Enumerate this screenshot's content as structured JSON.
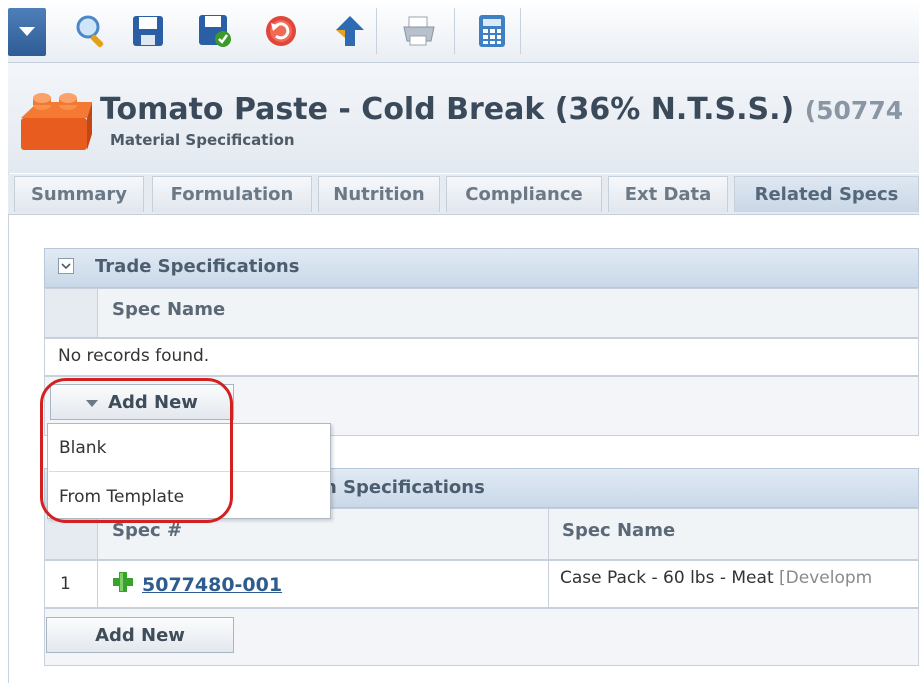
{
  "toolbar": {
    "icons": [
      "dropdown-arrow-icon",
      "search-icon",
      "save-icon",
      "save-check-icon",
      "undo-icon",
      "arrow-up-icon",
      "print-icon",
      "calculator-icon"
    ]
  },
  "header": {
    "title": "Tomato Paste - Cold Break (36% N.T.S.S.)",
    "code": "(50774",
    "subtitle": "Material Specification"
  },
  "tabs": [
    {
      "label": "Summary"
    },
    {
      "label": "Formulation"
    },
    {
      "label": "Nutrition"
    },
    {
      "label": "Compliance"
    },
    {
      "label": "Ext Data"
    },
    {
      "label": "Related Specs",
      "active": true
    }
  ],
  "trade_specs": {
    "title": "Trade Specifications",
    "column": "Spec Name",
    "empty": "No records found.",
    "add_new": "Add New",
    "menu": [
      "Blank",
      "From Template"
    ]
  },
  "second_panel": {
    "title_partial": "n Specifications",
    "columns": [
      "Spec #",
      "Spec Name"
    ],
    "rows": [
      {
        "index": "1",
        "spec_no": "5077480-001",
        "spec_name": "Case Pack - 60 lbs - Meat",
        "status": "[Developm"
      }
    ],
    "add_new": "Add New"
  },
  "colors": {
    "accent": "#2f5c8e",
    "highlight": "#d32020",
    "header_bg": "#c9d8e8"
  }
}
